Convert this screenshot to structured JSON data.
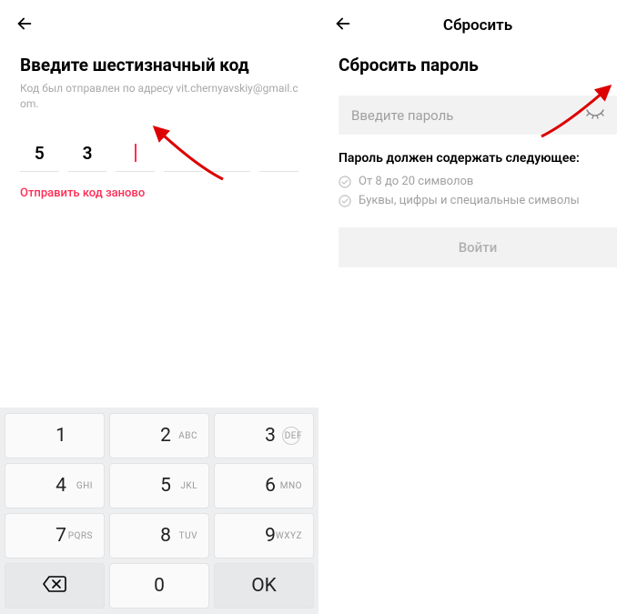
{
  "left": {
    "title": "Введите шестизначный код",
    "subtitle_prefix": "Код был отправлен по адресу ",
    "email": "vit.chernyavskiy@gmail.com.",
    "code": [
      "5",
      "3",
      "",
      "",
      "",
      ""
    ],
    "resend": "Отправить код заново"
  },
  "right": {
    "header_title": "Сбросить",
    "title": "Сбросить пароль",
    "password_placeholder": "Введите пароль",
    "rules_title": "Пароль должен содержать следующее:",
    "rules": [
      "От 8 до 20 символов",
      "Буквы, цифры и специальные символы"
    ],
    "login_label": "Войти"
  },
  "keyboard": {
    "keys": [
      {
        "num": "1",
        "sub": ""
      },
      {
        "num": "2",
        "sub": "ABC"
      },
      {
        "num": "3",
        "sub": "DEF"
      },
      {
        "num": "4",
        "sub": "GHI"
      },
      {
        "num": "5",
        "sub": "JKL"
      },
      {
        "num": "6",
        "sub": "MNO"
      },
      {
        "num": "7",
        "sub": "PQRS"
      },
      {
        "num": "8",
        "sub": "TUV"
      },
      {
        "num": "9",
        "sub": "WXYZ"
      }
    ],
    "zero": "0",
    "ok": "OK"
  }
}
